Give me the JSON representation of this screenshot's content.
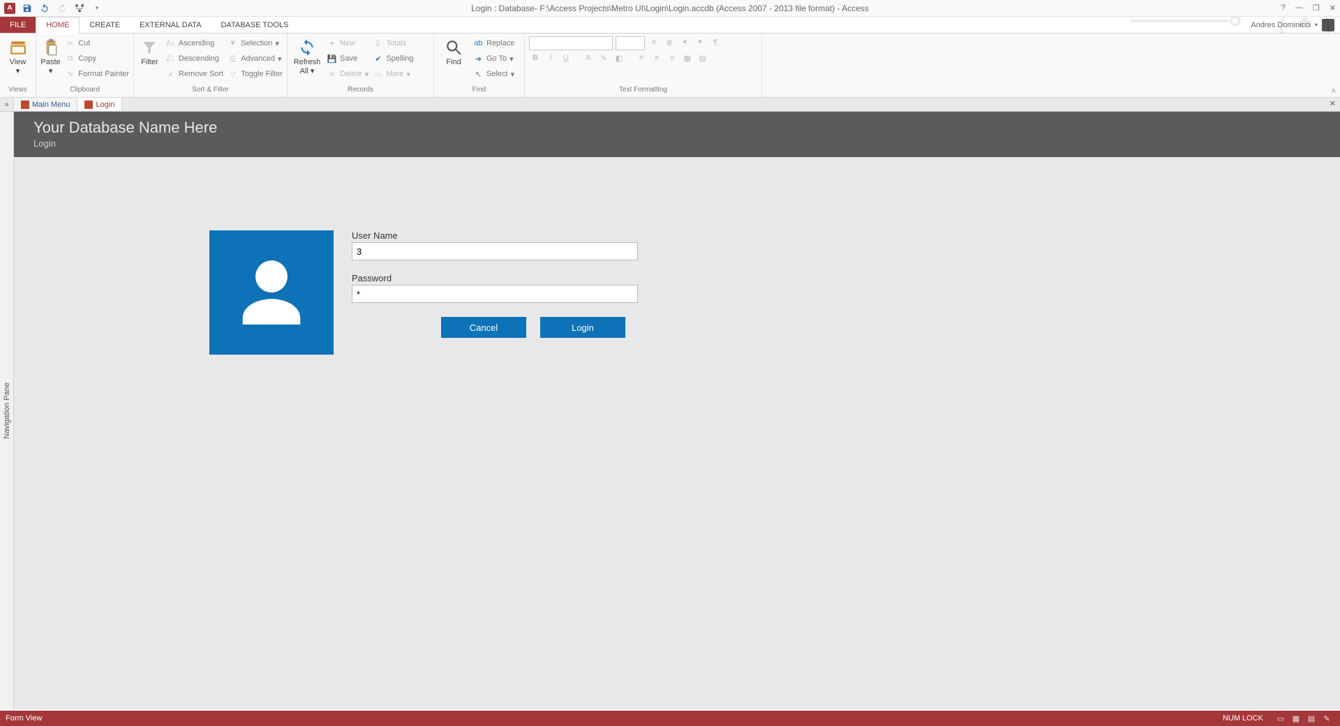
{
  "titlebar": {
    "title": "Login : Database- F:\\Access Projects\\Metro UI\\Login\\Login.accdb (Access 2007 - 2013 file format) - Access"
  },
  "account": {
    "name": "Andres Dominicci"
  },
  "tabs": {
    "file": "FILE",
    "home": "HOME",
    "create": "CREATE",
    "external": "EXTERNAL DATA",
    "dbtools": "DATABASE TOOLS"
  },
  "ribbon": {
    "views": {
      "view": "View",
      "label": "Views"
    },
    "clipboard": {
      "paste": "Paste",
      "cut": "Cut",
      "copy": "Copy",
      "format_painter": "Format Painter",
      "label": "Clipboard"
    },
    "sortfilter": {
      "filter": "Filter",
      "asc": "Ascending",
      "desc": "Descending",
      "remove_sort": "Remove Sort",
      "selection": "Selection",
      "advanced": "Advanced",
      "toggle": "Toggle Filter",
      "label": "Sort & Filter"
    },
    "records": {
      "refresh": "Refresh",
      "all": "All",
      "new": "New",
      "save": "Save",
      "delete": "Delete",
      "totals": "Totals",
      "spelling": "Spelling",
      "more": "More",
      "label": "Records"
    },
    "find": {
      "find": "Find",
      "replace": "Replace",
      "goto": "Go To",
      "select": "Select",
      "label": "Find"
    },
    "textfmt": {
      "label": "Text Formatting"
    }
  },
  "doctabs": {
    "main": "Main Menu",
    "login": "Login"
  },
  "navpane": {
    "label": "Navigation Pane"
  },
  "form": {
    "header_title": "Your Database Name Here",
    "header_sub": "Login",
    "username_label": "User Name",
    "username_value": "3",
    "password_label": "Password",
    "password_value": "*",
    "cancel": "Cancel",
    "login": "Login"
  },
  "statusbar": {
    "view": "Form View",
    "numlock": "NUM LOCK"
  }
}
